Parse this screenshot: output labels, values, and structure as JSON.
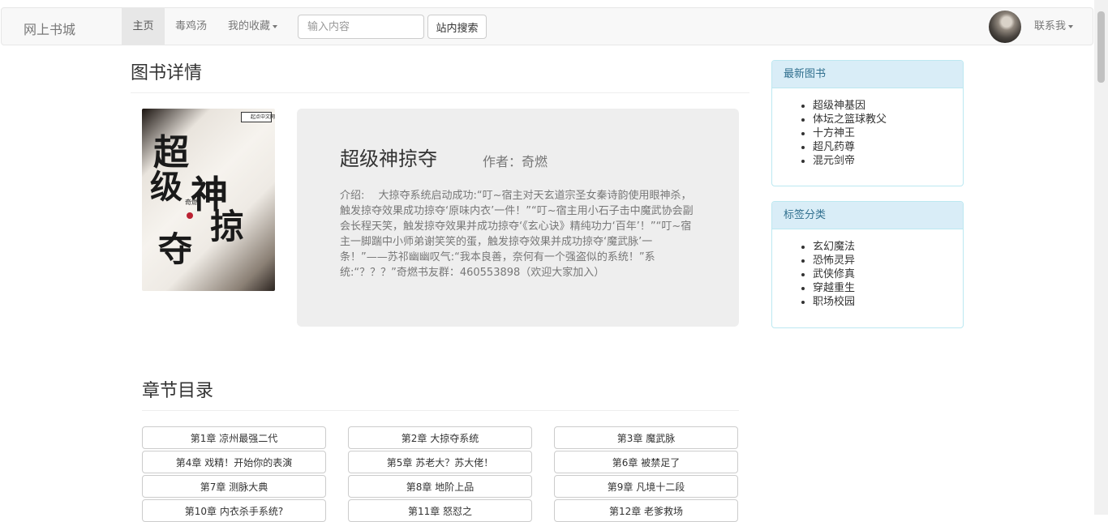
{
  "navbar": {
    "brand": "网上书城",
    "home": "主页",
    "soup": "毒鸡汤",
    "favorites": "我的收藏",
    "search_placeholder": "输入内容",
    "search_button": "站内搜索",
    "contact": "联系我"
  },
  "page": {
    "title": "图书详情"
  },
  "cover": {
    "glyphs": [
      "超",
      "级",
      "神",
      "掠",
      "夺"
    ],
    "author": "奇燃",
    "logo": "起点中文网"
  },
  "book": {
    "title": "超级神掠夺",
    "author_label": "作者：奇燃",
    "intro": "介绍:　 大掠夺系统启动成功:“叮~宿主对天玄道宗圣女秦诗韵使用眼神杀，触发掠夺效果成功掠夺‘原味内衣’一件！”“叮~宿主用小石子击中魔武协会副会长程天笑，触发掠夺效果并成功掠夺‘《玄心诀》精纯功力‘百年’！”“叮~宿主一脚踹中小师弟谢笑笑的蛋，触发掠夺效果并成功掠夺‘魔武脉’一条！”——苏祁幽幽叹气:“我本良善，奈何有一个强盗似的系统！”系统:“？？？”奇燃书友群：460553898（欢迎大家加入）"
  },
  "chapters": {
    "title": "章节目录",
    "items": [
      "第1章 凉州最强二代",
      "第2章 大掠夺系统",
      "第3章 魔武脉",
      "第4章 戏精！开始你的表演",
      "第5章 苏老大？苏大佬！",
      "第6章 被禁足了",
      "第7章 测脉大典",
      "第8章 地阶上品",
      "第9章 凡境十二段",
      "第10章 内衣杀手系统?",
      "第11章 怒怼之",
      "第12章 老爹救场"
    ]
  },
  "sidebar": {
    "latest": {
      "heading": "最新图书",
      "items": [
        "超级神基因",
        "体坛之篮球教父",
        "十方神王",
        "超凡药尊",
        "混元剑帝"
      ]
    },
    "tags": {
      "heading": "标签分类",
      "items": [
        "玄幻魔法",
        "恐怖灵异",
        "武侠修真",
        "穿越重生",
        "职场校园"
      ]
    }
  }
}
